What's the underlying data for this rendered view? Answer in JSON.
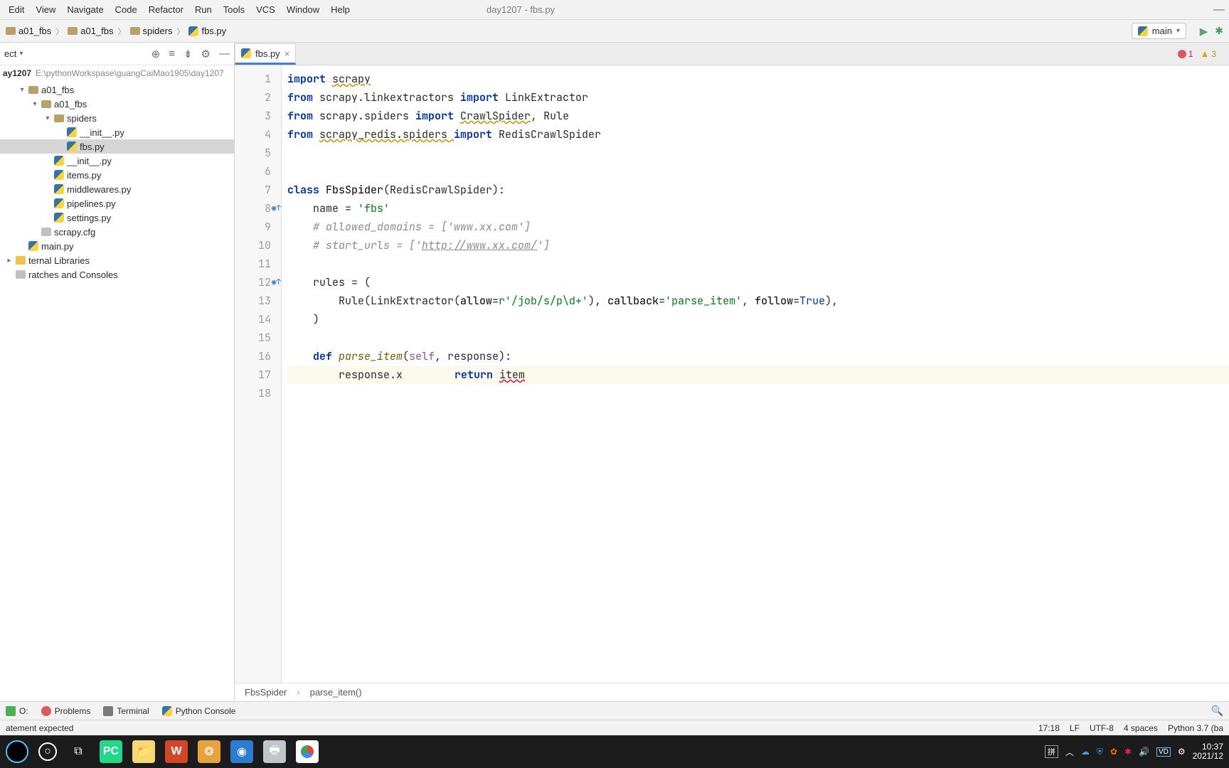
{
  "menu": {
    "items": [
      "Edit",
      "View",
      "Navigate",
      "Code",
      "Refactor",
      "Run",
      "Tools",
      "VCS",
      "Window",
      "Help"
    ],
    "mnemonics": [
      "E",
      "V",
      "N",
      "C",
      "R",
      "R",
      "T",
      "V",
      "W",
      "H"
    ]
  },
  "window_title": "day1207 - fbs.py",
  "minimize": "—",
  "breadcrumbs": [
    {
      "label": "a01_fbs",
      "type": "folder"
    },
    {
      "label": "a01_fbs",
      "type": "folder"
    },
    {
      "label": "spiders",
      "type": "folder"
    },
    {
      "label": "fbs.py",
      "type": "py"
    }
  ],
  "run_config": "main",
  "project": {
    "viewlabel": "ect",
    "root": "ay1207",
    "root_path": "E:\\pythonWorkspase\\guangCaiMao1905\\day1207",
    "nodes": [
      {
        "d": 1,
        "exp": "▾",
        "icon": "folder",
        "label": "a01_fbs"
      },
      {
        "d": 2,
        "exp": "▾",
        "icon": "folder",
        "label": "a01_fbs"
      },
      {
        "d": 3,
        "exp": "▾",
        "icon": "folder",
        "label": "spiders"
      },
      {
        "d": 4,
        "exp": "",
        "icon": "py",
        "label": "__init__.py"
      },
      {
        "d": 4,
        "exp": "",
        "icon": "py",
        "label": "fbs.py",
        "sel": true
      },
      {
        "d": 3,
        "exp": "",
        "icon": "py",
        "label": "__init__.py"
      },
      {
        "d": 3,
        "exp": "",
        "icon": "py",
        "label": "items.py"
      },
      {
        "d": 3,
        "exp": "",
        "icon": "py",
        "label": "middlewares.py"
      },
      {
        "d": 3,
        "exp": "",
        "icon": "py",
        "label": "pipelines.py"
      },
      {
        "d": 3,
        "exp": "",
        "icon": "py",
        "label": "settings.py"
      },
      {
        "d": 2,
        "exp": "",
        "icon": "file",
        "label": "scrapy.cfg"
      },
      {
        "d": 1,
        "exp": "",
        "icon": "py",
        "label": "main.py"
      },
      {
        "d": 0,
        "exp": "▸",
        "icon": "lib",
        "label": "ternal Libraries"
      },
      {
        "d": 0,
        "exp": "",
        "icon": "scr",
        "label": "ratches and Consoles"
      }
    ]
  },
  "tab": {
    "label": "fbs.py"
  },
  "errors": {
    "error_count": "1",
    "warn_count": "3"
  },
  "code": {
    "lines": [
      {
        "n": 1,
        "mrk": "",
        "segs": [
          {
            "t": "import ",
            "c": "kw"
          },
          {
            "t": "scrapy",
            "c": "err2"
          }
        ]
      },
      {
        "n": 2,
        "mrk": "",
        "segs": [
          {
            "t": "from ",
            "c": "kw"
          },
          {
            "t": "scrapy.linkextractors ",
            "c": ""
          },
          {
            "t": "import ",
            "c": "kw"
          },
          {
            "t": "LinkExtractor",
            "c": ""
          }
        ]
      },
      {
        "n": 3,
        "mrk": "",
        "segs": [
          {
            "t": "from ",
            "c": "kw"
          },
          {
            "t": "scrapy.spiders ",
            "c": ""
          },
          {
            "t": "import ",
            "c": "kw"
          },
          {
            "t": "CrawlSpider",
            "c": "err2"
          },
          {
            "t": ", Rule",
            "c": ""
          }
        ]
      },
      {
        "n": 4,
        "mrk": "",
        "segs": [
          {
            "t": "from ",
            "c": "kw"
          },
          {
            "t": "scrapy_redis.spiders ",
            "c": "err2"
          },
          {
            "t": "import ",
            "c": "kw"
          },
          {
            "t": "RedisCrawlSpider",
            "c": ""
          }
        ]
      },
      {
        "n": 5,
        "mrk": "",
        "segs": [
          {
            "t": "",
            "c": ""
          }
        ]
      },
      {
        "n": 6,
        "mrk": "",
        "segs": [
          {
            "t": "",
            "c": ""
          }
        ]
      },
      {
        "n": 7,
        "mrk": "",
        "segs": [
          {
            "t": "class ",
            "c": "kw"
          },
          {
            "t": "FbsSpider",
            "c": "cls"
          },
          {
            "t": "(RedisCrawlSpider):",
            "c": ""
          }
        ]
      },
      {
        "n": 8,
        "mrk": "◉↑",
        "segs": [
          {
            "t": "    name = ",
            "c": ""
          },
          {
            "t": "'fbs'",
            "c": "str"
          }
        ]
      },
      {
        "n": 9,
        "mrk": "",
        "segs": [
          {
            "t": "    ",
            "c": ""
          },
          {
            "t": "# allowed_domains = ['www.xx.com']",
            "c": "cmt"
          }
        ]
      },
      {
        "n": 10,
        "mrk": "",
        "segs": [
          {
            "t": "    ",
            "c": ""
          },
          {
            "t": "# start_urls = ['",
            "c": "cmt"
          },
          {
            "t": "http://www.xx.com/",
            "c": "url"
          },
          {
            "t": "']",
            "c": "cmt"
          }
        ]
      },
      {
        "n": 11,
        "mrk": "",
        "segs": [
          {
            "t": "",
            "c": ""
          }
        ]
      },
      {
        "n": 12,
        "mrk": "◉↑",
        "segs": [
          {
            "t": "    rules = (",
            "c": ""
          }
        ]
      },
      {
        "n": 13,
        "mrk": "",
        "segs": [
          {
            "t": "        Rule(LinkExtractor(",
            "c": ""
          },
          {
            "t": "allow",
            "c": "param"
          },
          {
            "t": "=",
            "c": ""
          },
          {
            "t": "r'/job/s/p\\d+'",
            "c": "str"
          },
          {
            "t": "), ",
            "c": ""
          },
          {
            "t": "callback",
            "c": "param"
          },
          {
            "t": "=",
            "c": ""
          },
          {
            "t": "'parse_item'",
            "c": "str"
          },
          {
            "t": ", ",
            "c": ""
          },
          {
            "t": "follow",
            "c": "param"
          },
          {
            "t": "=",
            "c": ""
          },
          {
            "t": "True",
            "c": "kw2"
          },
          {
            "t": "),",
            "c": ""
          }
        ]
      },
      {
        "n": 14,
        "mrk": "",
        "segs": [
          {
            "t": "    )",
            "c": ""
          }
        ]
      },
      {
        "n": 15,
        "mrk": "",
        "segs": [
          {
            "t": "",
            "c": ""
          }
        ]
      },
      {
        "n": 16,
        "mrk": "",
        "segs": [
          {
            "t": "    ",
            "c": ""
          },
          {
            "t": "def ",
            "c": "kw"
          },
          {
            "t": "parse_item",
            "c": "fn"
          },
          {
            "t": "(",
            "c": ""
          },
          {
            "t": "self",
            "c": "self"
          },
          {
            "t": ", response):",
            "c": ""
          }
        ]
      },
      {
        "n": 17,
        "mrk": "",
        "cur": true,
        "segs": [
          {
            "t": "        response.x",
            "c": ""
          },
          {
            "t": "",
            "c": "caret"
          },
          {
            "t": "        ",
            "c": ""
          },
          {
            "t": "return ",
            "c": "kw"
          },
          {
            "t": "item",
            "c": "err"
          }
        ]
      },
      {
        "n": 18,
        "mrk": "",
        "segs": [
          {
            "t": "",
            "c": ""
          }
        ]
      }
    ]
  },
  "context_crumbs": [
    "FbsSpider",
    "parse_item()"
  ],
  "bottom_tools": [
    {
      "label": "O: "
    },
    {
      "label": "Problems",
      "icon": "prob"
    },
    {
      "label": "Terminal",
      "icon": "term"
    },
    {
      "label": "Python Console",
      "icon": "pyc"
    }
  ],
  "status": {
    "left": "atement expected",
    "caret": "17:18",
    "eol": "LF",
    "encoding": "UTF-8",
    "indent": "4 spaces",
    "sdk": "Python 3.7 (ba"
  },
  "taskbar": {
    "ime": "拼",
    "time": "10:37",
    "date": "2021/12"
  }
}
